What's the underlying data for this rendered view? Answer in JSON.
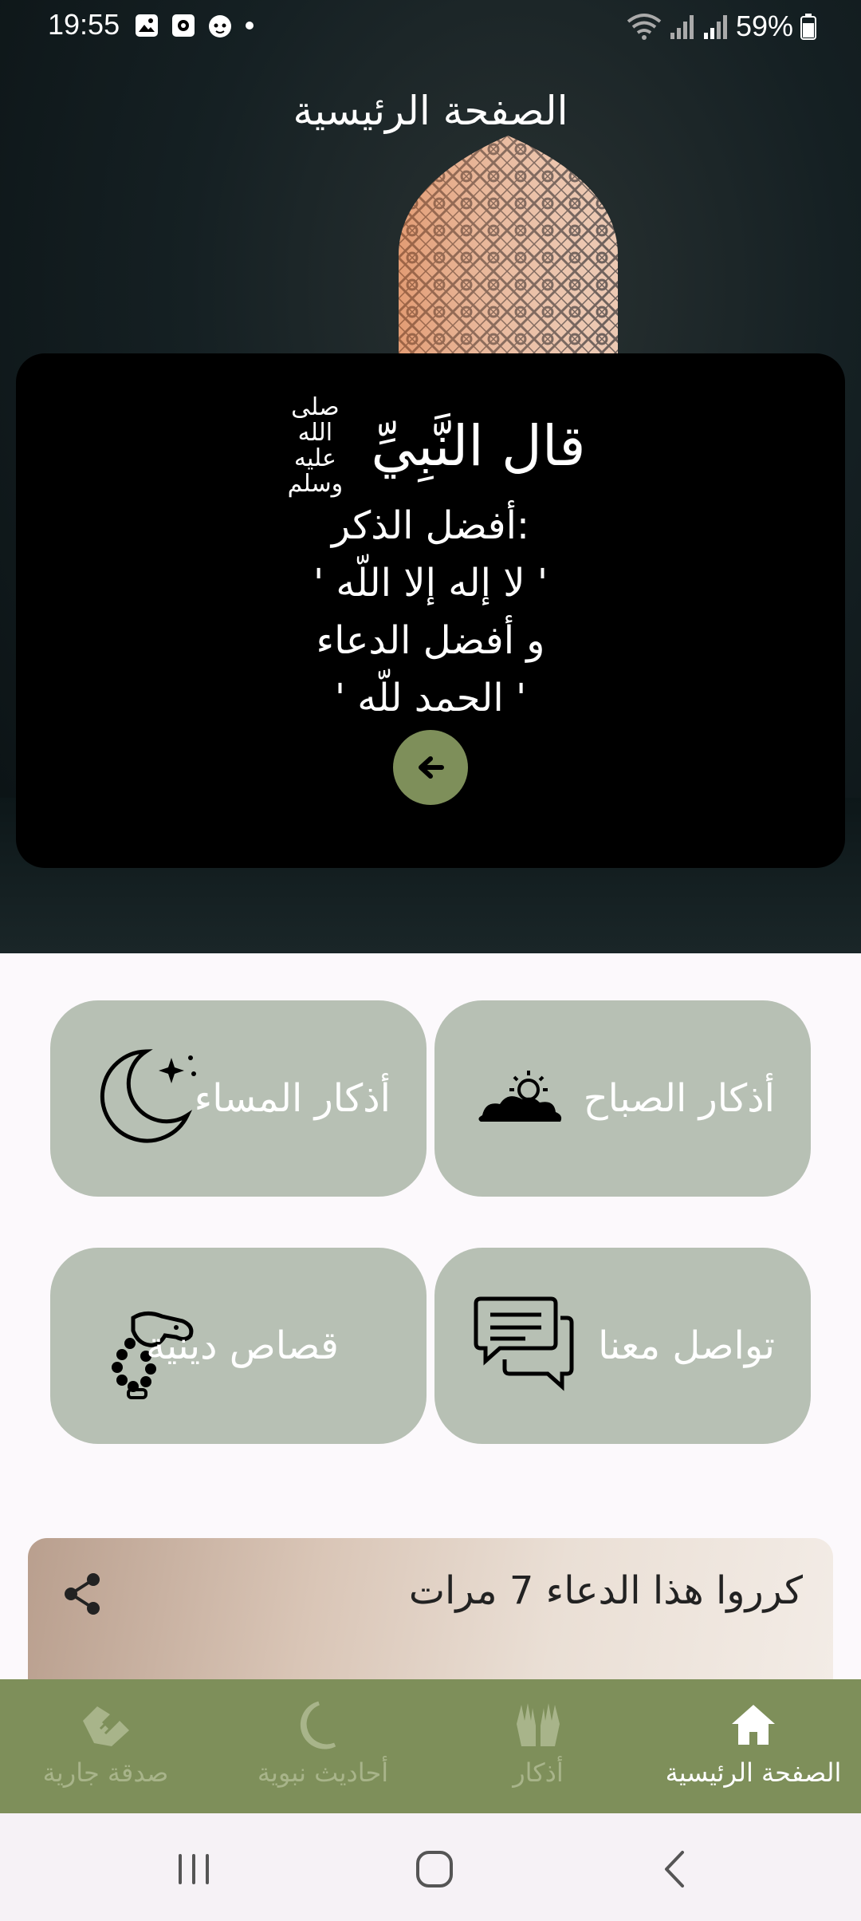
{
  "status_bar": {
    "time": "19:55",
    "battery": "59%"
  },
  "header": {
    "title": "الصفحة الرئيسية"
  },
  "quote": {
    "heading": "قال النَّبِيِّ",
    "honorific": "صلى الله عليه وسلم",
    "lines": [
      "أفضل الذكر:",
      "' لا إله إلا اللّه '",
      "و أفضل الدعاء",
      "' الحمد للّه '"
    ]
  },
  "menu": {
    "morning": "أذكار الصباح",
    "evening": "أذكار المساء",
    "contact": "تواصل معنا",
    "stories": "قصاص دينية"
  },
  "banner": {
    "text": "كرروا هذا الدعاء 7 مرات"
  },
  "bottom_nav": {
    "home": "الصفحة الرئيسية",
    "adhkar": "أذكار",
    "hadith": "أحاديث نبوية",
    "charity": "صدقة جارية"
  },
  "colors": {
    "accent": "#7e8f5a",
    "tile": "#b7c0b4",
    "card": "#000000"
  }
}
